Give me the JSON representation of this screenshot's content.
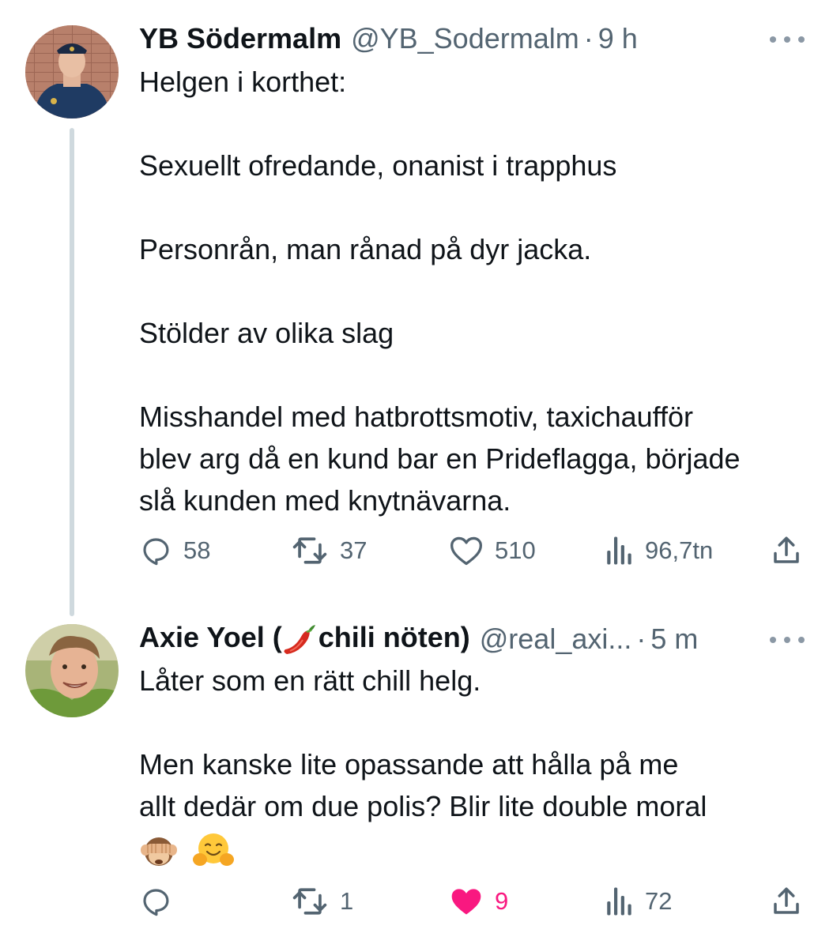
{
  "tweets": [
    {
      "author_name": "YB Södermalm",
      "handle": "@YB_Sodermalm",
      "separator": "·",
      "time": "9 h",
      "lines": [
        "Helgen i korthet:",
        "",
        "Sexuellt ofredande, onanist i trapphus",
        "",
        "Personrån, man rånad på dyr jacka.",
        "",
        "Stölder av olika slag",
        "",
        "Misshandel med hatbrottsmotiv, taxichaufför",
        "blev arg då en kund bar en Prideflagga, började",
        "slå kunden med knytnävarna."
      ],
      "stats": {
        "replies": "58",
        "retweets": "37",
        "likes": "510",
        "views": "96,7tn"
      },
      "icons": [
        "reply-icon",
        "retweet-icon",
        "like-icon",
        "views-icon",
        "share-icon",
        "more-icon"
      ]
    },
    {
      "author_name_prefix": "Axie Yoel (",
      "author_name_emoji": "chili-pepper",
      "author_name_suffix": "chili nöten)",
      "handle": "@real_axi...",
      "separator": "·",
      "time": "5 m",
      "lines": [
        "Låter som en rätt chill helg.",
        "",
        "Men kanske lite opassande att hålla på me",
        "allt dedär om due polis? Blir lite double moral"
      ],
      "emojis": [
        "see-no-evil-monkey",
        "hugging-face"
      ],
      "stats": {
        "replies": "",
        "retweets": "1",
        "likes": "9",
        "views": "72"
      },
      "liked": true,
      "colors": {
        "like": "#f91880",
        "muted": "#536471",
        "text": "#0f1419"
      }
    }
  ]
}
